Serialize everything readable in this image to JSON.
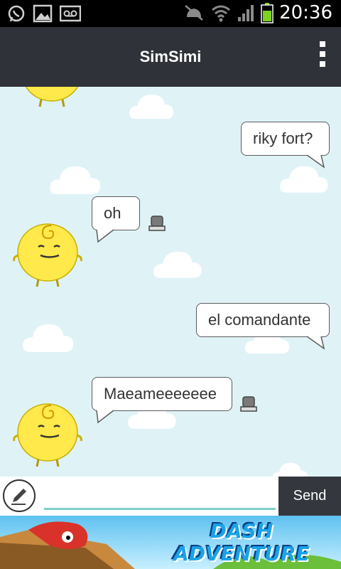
{
  "status_bar": {
    "time": "20:36",
    "icons": [
      "whatsapp-icon",
      "gallery-icon",
      "voicemail-icon",
      "mute-icon",
      "wifi-icon",
      "signal-icon",
      "battery-icon"
    ]
  },
  "app_bar": {
    "title": "SimSimi",
    "menu_icon": "overflow-menu-icon"
  },
  "messages": [
    {
      "from": "user",
      "text": "riky fort?"
    },
    {
      "from": "simsimi",
      "text": "oh",
      "has_stamp": true
    },
    {
      "from": "user",
      "text": "el comandante"
    },
    {
      "from": "simsimi",
      "text": "Maeameeeeeee",
      "has_stamp": true
    }
  ],
  "composer": {
    "edit_icon": "pencil-icon",
    "input_value": "",
    "send_label": "Send"
  },
  "ad_banner": {
    "text": "DASH ADVENTURE"
  },
  "colors": {
    "chat_bg": "#dff3f7",
    "app_bar": "#2f3238",
    "accent": "#7fcfc7",
    "avatar": "#ffe94b"
  }
}
